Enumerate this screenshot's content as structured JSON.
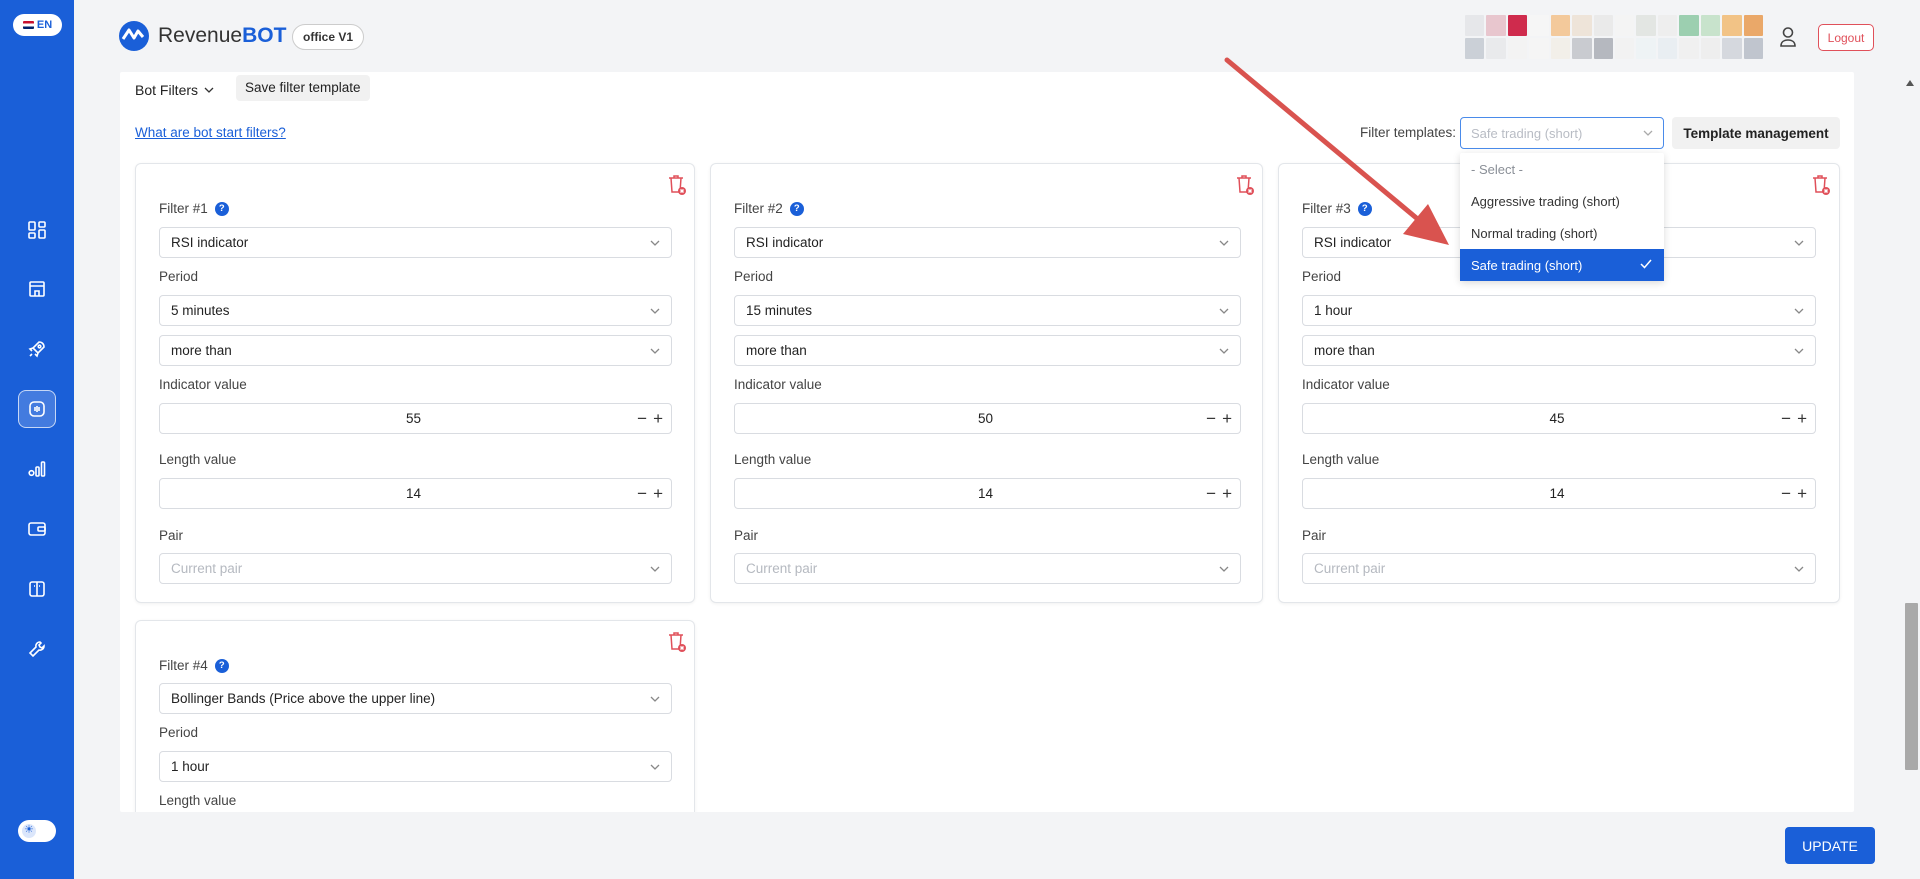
{
  "sidebar": {
    "language": "EN",
    "nav": [
      {
        "icon": "dashboard-icon"
      },
      {
        "icon": "store-icon"
      },
      {
        "icon": "rocket-icon"
      },
      {
        "icon": "bot-icon",
        "active": true
      },
      {
        "icon": "analytics-icon"
      },
      {
        "icon": "wallet-icon"
      },
      {
        "icon": "book-icon"
      },
      {
        "icon": "wrench-icon"
      }
    ]
  },
  "header": {
    "logo_prefix": "Revenue",
    "logo_suffix": "BOT",
    "office_badge": "office V1",
    "logout": "Logout"
  },
  "filters_bar": {
    "title": "Bot Filters",
    "save_template": "Save filter template",
    "help_link": "What are bot start filters?",
    "templates_label": "Filter templates:",
    "templates_selected": "Safe trading (short)",
    "template_management": "Template management"
  },
  "template_options": [
    {
      "label": "- Select -",
      "muted": true
    },
    {
      "label": "Aggressive trading (short)"
    },
    {
      "label": "Normal trading (short)"
    },
    {
      "label": "Safe trading (short)",
      "selected": true
    }
  ],
  "labels": {
    "period": "Period",
    "indicator_value": "Indicator value",
    "length_value": "Length value",
    "pair": "Pair",
    "pair_placeholder": "Current pair"
  },
  "filters": [
    {
      "title": "Filter #1",
      "indicator": "RSI indicator",
      "period": "5 minutes",
      "condition": "more than",
      "indicator_value": "55",
      "length_value": "14"
    },
    {
      "title": "Filter #2",
      "indicator": "RSI indicator",
      "period": "15 minutes",
      "condition": "more than",
      "indicator_value": "50",
      "length_value": "14"
    },
    {
      "title": "Filter #3",
      "indicator": "RSI indicator",
      "period": "1 hour",
      "condition": "more than",
      "indicator_value": "45",
      "length_value": "14"
    },
    {
      "title": "Filter #4",
      "indicator": "Bollinger Bands (Price above the upper line)",
      "period": "1 hour"
    }
  ],
  "update_button": "UPDATE",
  "colors": {
    "accent": "#1a5fd8",
    "danger": "#e0505a",
    "arrow": "#d9534f"
  }
}
